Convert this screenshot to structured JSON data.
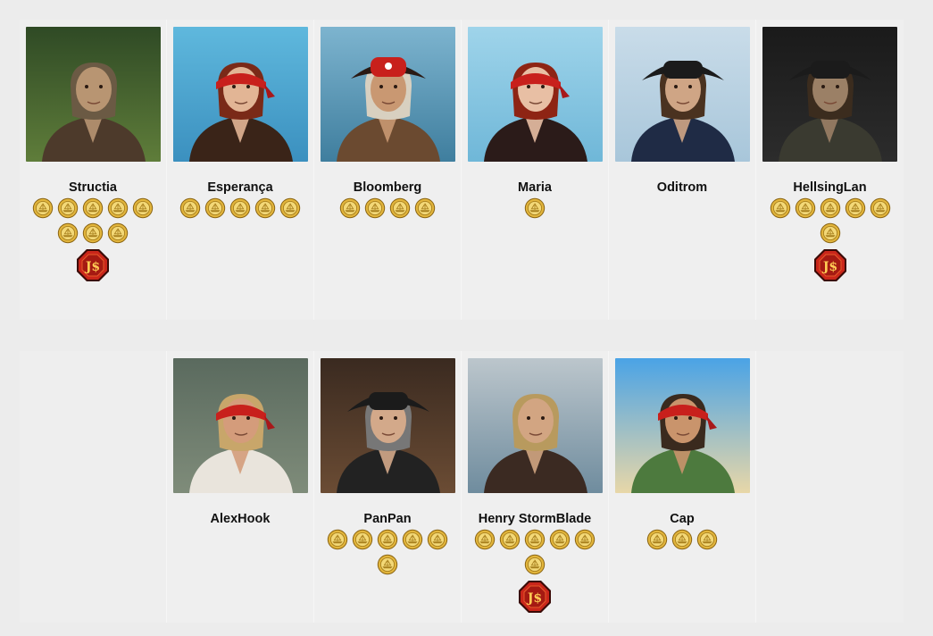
{
  "rows": [
    [
      {
        "name": "Structia",
        "coins": 8,
        "badge": true,
        "colors": {
          "bg": "#2f4a25",
          "bg2": "#5f7d3a",
          "skin": "#b89572",
          "hair": "#6b5a44",
          "hat": "none",
          "coat": "#4d3a2b"
        }
      },
      {
        "name": "Esperança",
        "coins": 5,
        "badge": false,
        "colors": {
          "bg": "#5fb8dd",
          "bg2": "#3b90bf",
          "skin": "#e2b595",
          "hair": "#7a2a18",
          "hat": "bandana",
          "coat": "#3a2418"
        }
      },
      {
        "name": "Bloomberg",
        "coins": 4,
        "badge": false,
        "colors": {
          "bg": "#7db4cf",
          "bg2": "#3f7e9e",
          "skin": "#c99872",
          "hair": "#d8d0c0",
          "hat": "tricorn-red",
          "coat": "#6b4a30"
        }
      },
      {
        "name": "Maria",
        "coins": 1,
        "badge": false,
        "colors": {
          "bg": "#9fd4ea",
          "bg2": "#6fb7d8",
          "skin": "#e8bfa4",
          "hair": "#8e2414",
          "hat": "bandana",
          "coat": "#2b1b19"
        }
      },
      {
        "name": "Oditrom",
        "coins": 0,
        "badge": false,
        "colors": {
          "bg": "#c9dce9",
          "bg2": "#a8c6da",
          "skin": "#cfa585",
          "hair": "#4a3220",
          "hat": "tricorn",
          "coat": "#1f2b45"
        }
      },
      {
        "name": "HellsingLan",
        "coins": 6,
        "badge": true,
        "colors": {
          "bg": "#1a1a1a",
          "bg2": "#2c2c2c",
          "skin": "#9b8066",
          "hair": "#3b2c1e",
          "hat": "tricorn",
          "coat": "#3a3a30"
        }
      }
    ],
    [
      null,
      {
        "name": "AlexHook",
        "coins": 0,
        "badge": false,
        "colors": {
          "bg": "#5a6a5e",
          "bg2": "#7f8c7a",
          "skin": "#d49c7b",
          "hair": "#c8a66a",
          "hat": "bandana",
          "coat": "#e9e4dc"
        }
      },
      {
        "name": "PanPan",
        "coins": 6,
        "badge": false,
        "colors": {
          "bg": "#3a2a20",
          "bg2": "#6b4c34",
          "skin": "#d3a98a",
          "hair": "#777777",
          "hat": "tricorn",
          "coat": "#222222"
        }
      },
      {
        "name": "Henry StormBlade",
        "coins": 6,
        "badge": true,
        "colors": {
          "bg": "#bcc6cc",
          "bg2": "#6f8c9e",
          "skin": "#d2a582",
          "hair": "#b89a5e",
          "hat": "none",
          "coat": "#3b2a22"
        }
      },
      {
        "name": "Cap",
        "coins": 3,
        "badge": false,
        "colors": {
          "bg": "#4aa3e6",
          "bg2": "#e8d7a8",
          "skin": "#c9946c",
          "hair": "#3a2a1e",
          "hat": "bandana",
          "coat": "#4d7a3e"
        }
      },
      null
    ]
  ]
}
